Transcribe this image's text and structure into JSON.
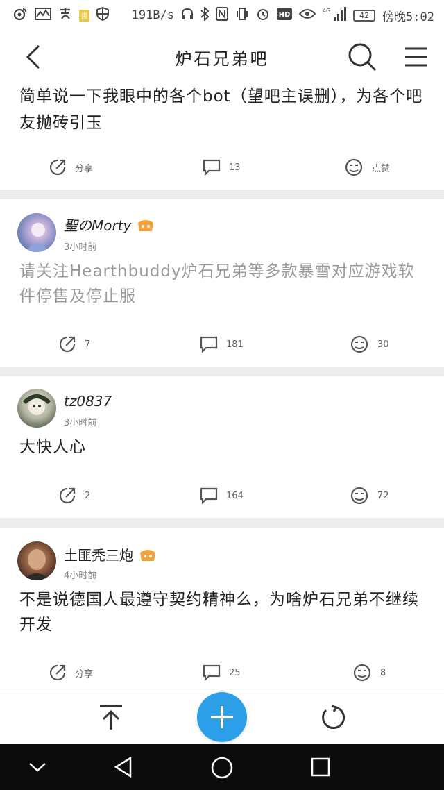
{
  "status_bar": {
    "left_icons": [
      "weibo-icon",
      "pulse-icon",
      "alipay-icon",
      "badge-icon",
      "shield-icon"
    ],
    "speed": "191B/s",
    "network": "4G",
    "battery": "42",
    "time": "傍晚5:02"
  },
  "header": {
    "title": "炉石兄弟吧"
  },
  "posts": [
    {
      "text": "简单说一下我眼中的各个bot（望吧主误删），为各个吧友抛砖引玉",
      "share_label": "分享",
      "comments": "13",
      "like_label": "点赞"
    },
    {
      "author": "聖のMorty",
      "time": "3小时前",
      "text": "请关注Hearthbuddy炉石兄弟等多款暴雪对应游戏软件停售及停止服",
      "share_label": "7",
      "comments": "181",
      "like_label": "30"
    },
    {
      "author": "tz0837",
      "time": "3小时前",
      "text": "大快人心",
      "share_label": "2",
      "comments": "164",
      "like_label": "72"
    },
    {
      "author": "土匪秃三炮",
      "time": "4小时前",
      "text": "不是说德国人最遵守契约精神么，为啥炉石兄弟不继续开发",
      "share_label": "分享",
      "comments": "25",
      "like_label": "8"
    }
  ],
  "colors": {
    "accent": "#2c9fe9",
    "muted_text": "#9a9a9a",
    "background": "#ededf0"
  }
}
